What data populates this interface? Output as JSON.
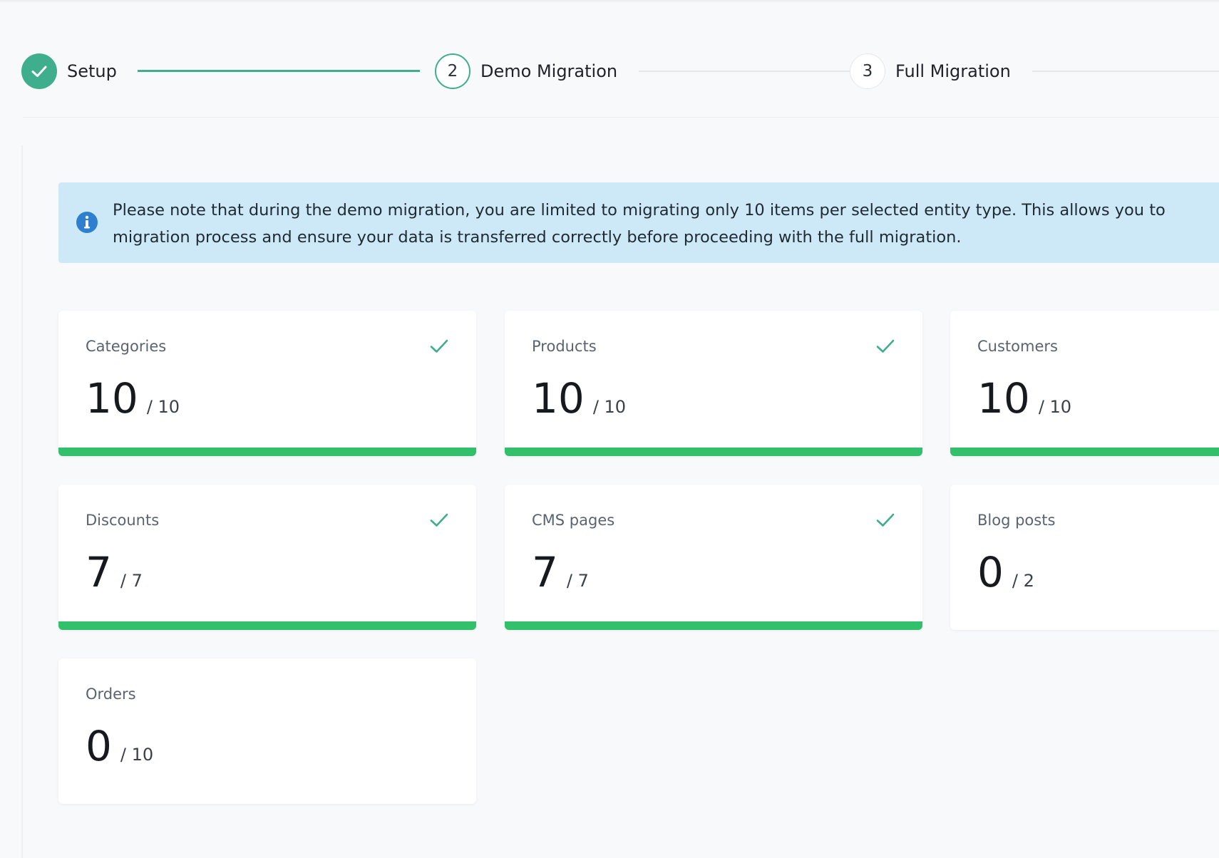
{
  "stepper": {
    "steps": [
      {
        "number": "",
        "label": "Setup",
        "state": "done"
      },
      {
        "number": "2",
        "label": "Demo Migration",
        "state": "active"
      },
      {
        "number": "3",
        "label": "Full Migration",
        "state": "pending"
      }
    ]
  },
  "info": {
    "line1": "Please note that during the demo migration, you are limited to migrating only 10 items per selected entity type. This allows you to",
    "line2": "migration process and ensure your data is transferred correctly before proceeding with the full migration."
  },
  "cards": [
    {
      "title": "Categories",
      "count": "10",
      "total": "/ 10",
      "progress": 1.0,
      "complete": true
    },
    {
      "title": "Products",
      "count": "10",
      "total": "/ 10",
      "progress": 1.0,
      "complete": true
    },
    {
      "title": "Customers",
      "count": "10",
      "total": "/ 10",
      "progress": 1.0,
      "complete": true
    },
    {
      "title": "Discounts",
      "count": "7",
      "total": "/ 7",
      "progress": 1.0,
      "complete": true
    },
    {
      "title": "CMS pages",
      "count": "7",
      "total": "/ 7",
      "progress": 1.0,
      "complete": true
    },
    {
      "title": "Blog posts",
      "count": "0",
      "total": "/ 2",
      "progress": 0.0,
      "complete": false
    },
    {
      "title": "Orders",
      "count": "0",
      "total": "/ 10",
      "progress": 0.0,
      "complete": false
    }
  ],
  "colors": {
    "accent": "#3fae8c",
    "progress": "#33c06b",
    "info_background": "#cde9f8",
    "info_icon": "#2f7fd0"
  }
}
